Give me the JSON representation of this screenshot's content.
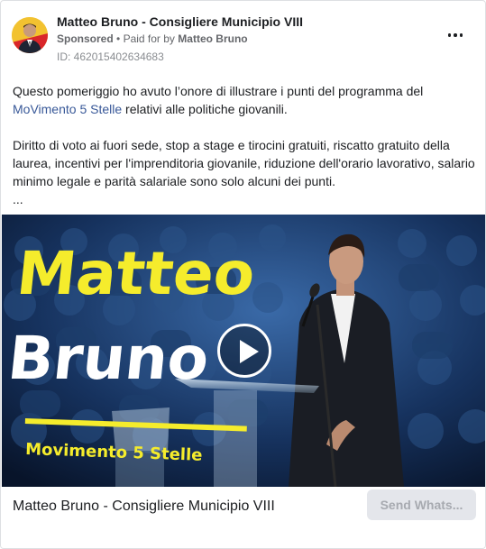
{
  "post": {
    "page_name": "Matteo Bruno - Consigliere Municipio VIII",
    "sponsored_label": "Sponsored",
    "separator": "•",
    "paid_for_prefix": "Paid for by",
    "paid_for_name": "Matteo Bruno",
    "ad_id": "ID: 462015402634683",
    "menu_icon": "more-horizontal-icon",
    "body": {
      "paragraph1_before_link": "Questo pomeriggio ho avuto l’onore di illustrare i punti del programma del ",
      "paragraph1_link": "MoVimento 5 Stelle",
      "paragraph1_after_link": " relativi alle politiche giovanili.",
      "paragraph2": "Diritto di voto ai fuori sede, stop a stage e tirocini gratuiti, riscatto gratuito della laurea, incentivi per l'imprenditoria giovanile, riduzione dell'orario lavorativo, salario minimo legale e parità salariale sono solo alcuni dei punti.",
      "truncation": "..."
    },
    "video": {
      "overlay_line1": "Matteo",
      "overlay_line2": "Bruno",
      "overlay_tagline": "Movimento 5 Stelle",
      "play_icon": "play-icon"
    },
    "footer": {
      "title": "Matteo Bruno - Consigliere Municipio VIII",
      "cta_label": "Send Whats..."
    }
  },
  "colors": {
    "link": "#385898",
    "text": "#1c1e21",
    "secondary_text": "#65676b",
    "overlay_yellow": "#f5ec2c",
    "cta_bg": "#e4e6eb"
  }
}
